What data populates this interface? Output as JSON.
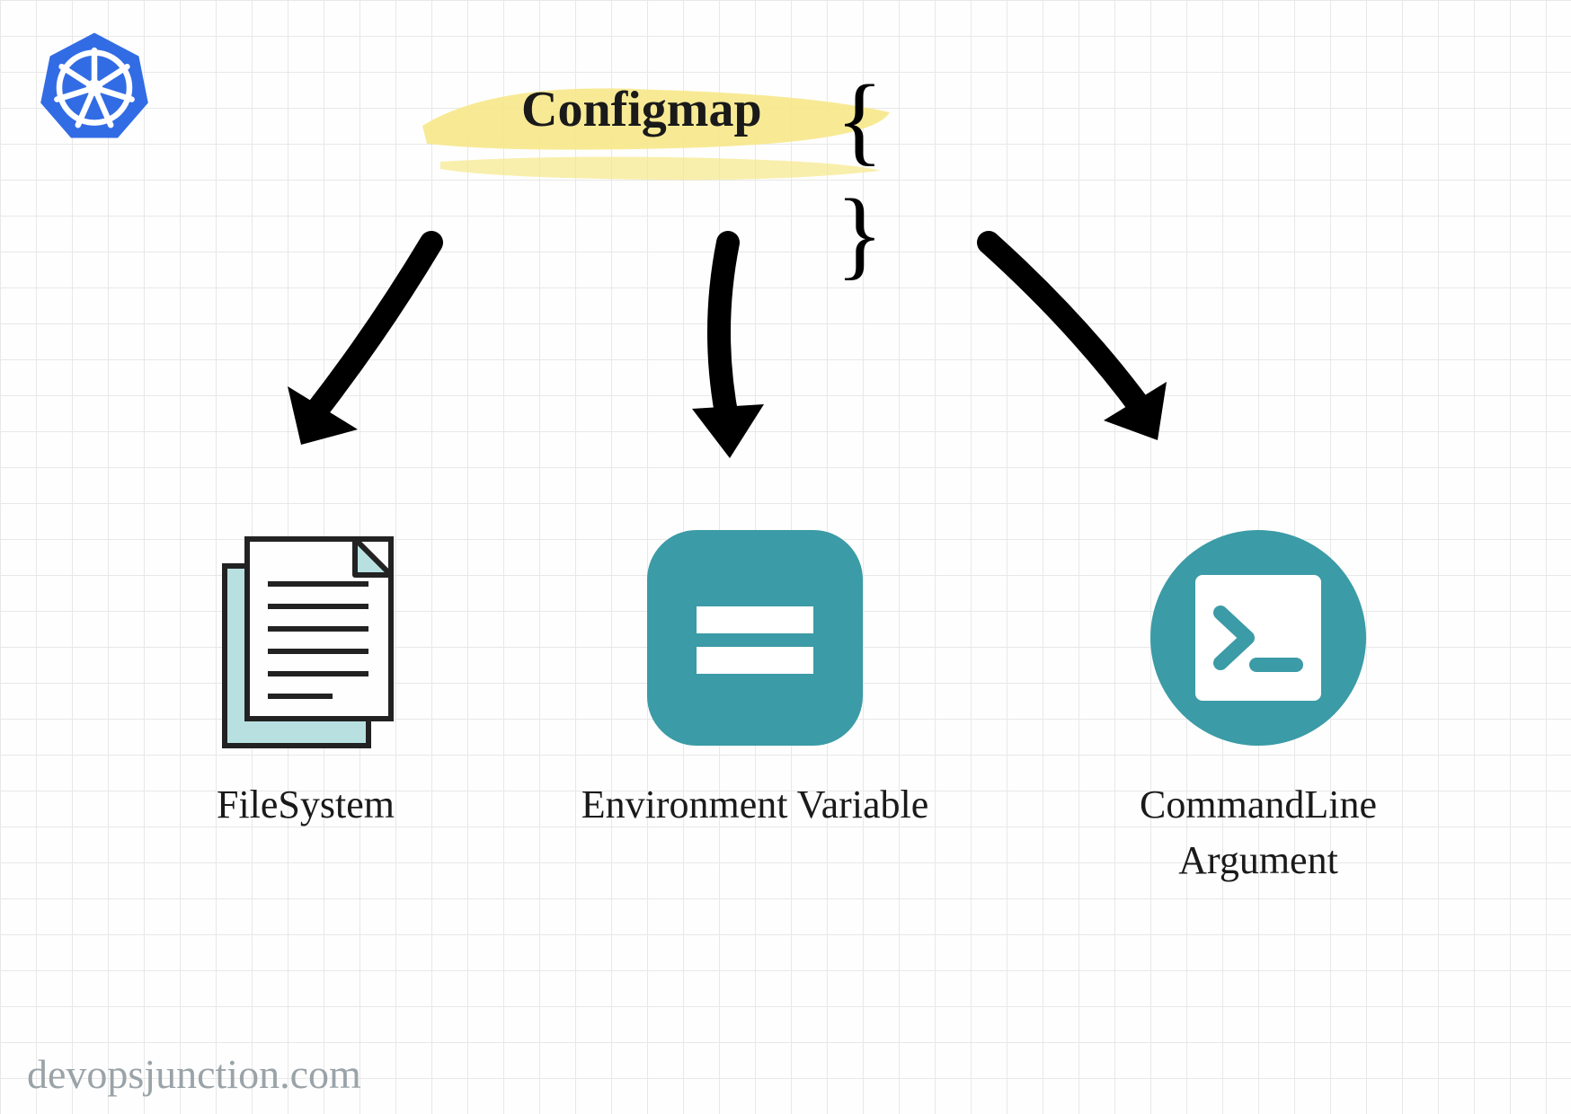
{
  "title": "Configmap",
  "braces": "{ }",
  "nodes": {
    "filesystem": {
      "label": "FileSystem"
    },
    "env": {
      "label": "Environment Variable"
    },
    "cli": {
      "label": "CommandLine\nArgument"
    }
  },
  "watermark": "devopsjunction.com",
  "colors": {
    "teal": "#3b9ba6",
    "highlight": "#f7e889",
    "k8s": "#326ce5"
  }
}
